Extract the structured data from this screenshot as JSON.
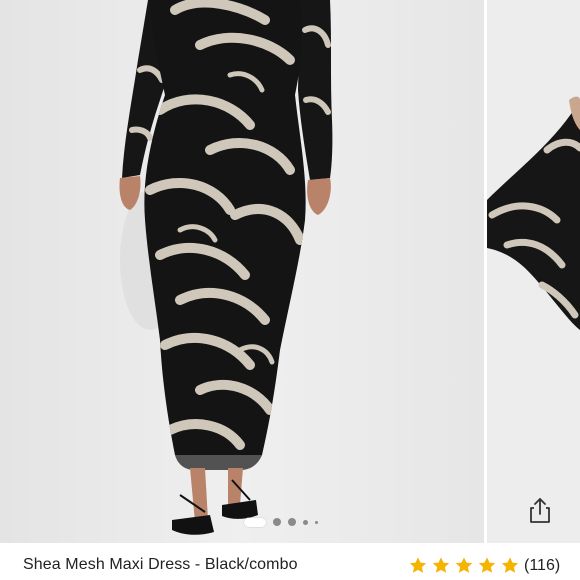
{
  "product": {
    "title": "Shea Mesh Maxi Dress - Black/combo",
    "rating_value": 5,
    "rating_max": 5,
    "review_count": "(116)"
  },
  "carousel": {
    "total_slides": 5,
    "active_index": 0
  },
  "colors": {
    "star": "#f5b400",
    "dress_base": "#141414",
    "dress_print": "#cfc7ba",
    "background": "#ececec"
  },
  "icons": {
    "share": "share-icon",
    "star": "star-icon"
  }
}
